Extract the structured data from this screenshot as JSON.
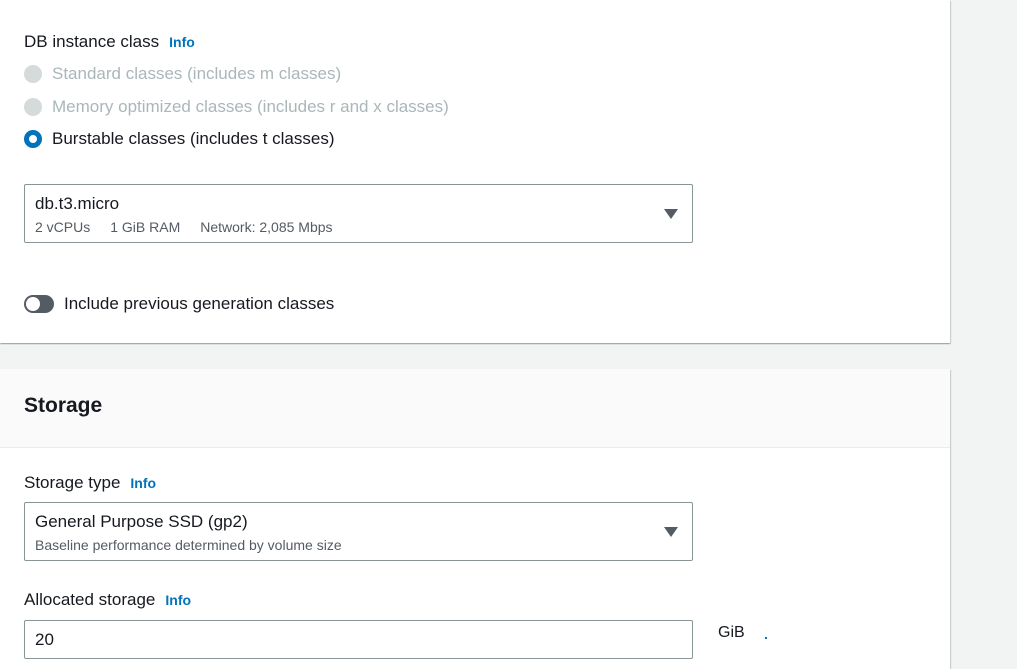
{
  "instance_class": {
    "label": "DB instance class",
    "info": "Info",
    "options": [
      {
        "label": "Standard classes (includes m classes)",
        "state": "disabled"
      },
      {
        "label": "Memory optimized classes (includes r and x classes)",
        "state": "disabled"
      },
      {
        "label": "Burstable classes (includes t classes)",
        "state": "selected"
      }
    ],
    "select": {
      "value": "db.t3.micro",
      "vcpus": "2 vCPUs",
      "ram": "1 GiB RAM",
      "network": "Network: 2,085 Mbps"
    },
    "toggle_label": "Include previous generation classes",
    "toggle_on": false
  },
  "storage": {
    "title": "Storage",
    "type_label": "Storage type",
    "type_info": "Info",
    "type_value": "General Purpose SSD (gp2)",
    "type_description": "Baseline performance determined by volume size",
    "allocated_label": "Allocated storage",
    "allocated_info": "Info",
    "allocated_value": "20",
    "allocated_unit": "GiB"
  },
  "colors": {
    "accent": "#0073bb",
    "disabled": "#aab7b8",
    "page_bg": "#f2f3f3"
  }
}
